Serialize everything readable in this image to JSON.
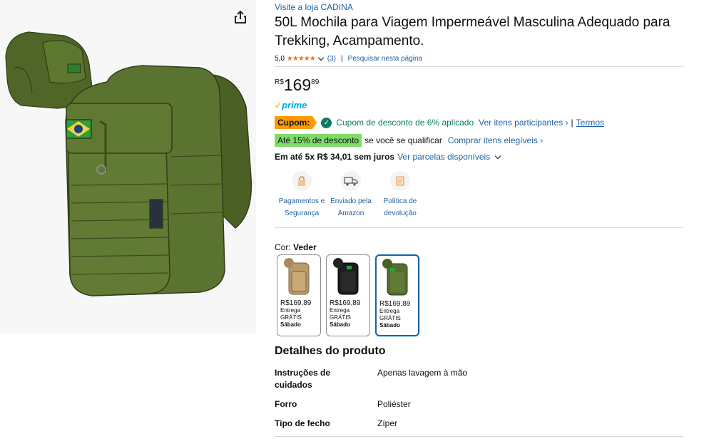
{
  "store": {
    "link": "Visite a loja CADINA"
  },
  "title": "50L Mochila para Viagem Impermeável Masculina Adequado para Trekking, Acampamento.",
  "rating": {
    "value": "5,0",
    "stars": "★★★★★",
    "count": "(3)",
    "search_link": "Pesquisar nesta página"
  },
  "price": {
    "currency": "R$",
    "whole": "169",
    "fraction": "89"
  },
  "prime": {
    "check": "✓",
    "label": "prime"
  },
  "coupon": {
    "badge": "Cupom:",
    "text": "Cupom de desconto de 6% aplicado",
    "items_link": "Ver itens participantes ›",
    "separator": "|",
    "terms_link": "Termos"
  },
  "discount": {
    "badge": "Até 15% de desconto",
    "text": "se você se qualificar",
    "link": "Comprar itens elegíveis ›"
  },
  "installments": {
    "bold": "Em até 5x R$ 34,01 sem juros",
    "link": "Ver parcelas disponíveis"
  },
  "features": [
    {
      "icon": "payment-security-icon",
      "label": "Pagamentos e Segurança"
    },
    {
      "icon": "amazon-delivery-icon",
      "label": "Enviado pela Amazon"
    },
    {
      "icon": "return-policy-icon",
      "label": "Política de devolução"
    }
  ],
  "color": {
    "label": "Cor:",
    "value": "Veder"
  },
  "swatches": [
    {
      "price": "R$169,89",
      "line1": "Entrega",
      "line2": "GRÁTIS",
      "day": "Sábado",
      "tone": "#b99a6b"
    },
    {
      "price": "R$169,89",
      "line1": "Entrega",
      "line2": "GRÁTIS",
      "day": "Sábado",
      "tone": "#1d1d1d"
    },
    {
      "price": "R$169,89",
      "line1": "Entrega",
      "line2": "GRÁTIS",
      "day": "Sábado",
      "tone": "#556b2f"
    }
  ],
  "details": {
    "title": "Detalhes do produto",
    "rows": [
      {
        "key": "Instruções de cuidados",
        "value": "Apenas lavagem à mão"
      },
      {
        "key": "Forro",
        "value": "Poliéster"
      },
      {
        "key": "Tipo de fecho",
        "value": "Zíper"
      }
    ]
  }
}
